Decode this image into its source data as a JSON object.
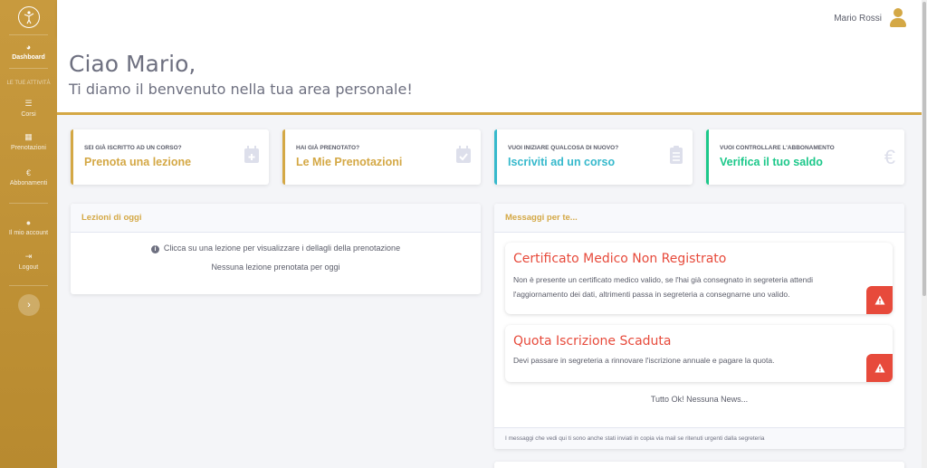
{
  "sidebar": {
    "items": [
      {
        "label": "Dashboard",
        "icon": "gauge-icon"
      },
      {
        "label": "Corsi",
        "icon": "list-icon"
      },
      {
        "label": "Prenotazioni",
        "icon": "calendar-icon"
      },
      {
        "label": "Abbonamenti",
        "icon": "euro-icon"
      },
      {
        "label": "Il mio account",
        "icon": "user-icon"
      },
      {
        "label": "Logout",
        "icon": "logout-icon"
      }
    ],
    "section_heading": "LE TUE ATTIVITÀ"
  },
  "topbar": {
    "user_name": "Mario Rossi"
  },
  "welcome": {
    "greeting": "Ciao Mario,",
    "subtitle": "Ti diamo il benvenuto nella tua area personale!"
  },
  "cards": [
    {
      "kicker": "SEI GIÀ ISCRITTO AD UN CORSO?",
      "title": "Prenota una lezione",
      "color": "#d4a845",
      "icon": "calendar-plus-icon"
    },
    {
      "kicker": "HAI GIÀ PRENOTATO?",
      "title": "Le Mie Prenotazioni",
      "color": "#d4a845",
      "icon": "calendar-check-icon"
    },
    {
      "kicker": "VUOI INIZIARE QUALCOSA DI NUOVO?",
      "title": "Iscriviti ad un corso",
      "color": "#36b9cc",
      "icon": "clipboard-list-icon"
    },
    {
      "kicker": "VUOI CONTROLLARE L'ABBONAMENTO",
      "title": "Verifica il tuo saldo",
      "color": "#1cc88a",
      "icon": "euro-icon"
    }
  ],
  "lessons_panel": {
    "title": "Lezioni di oggi",
    "info": "Clicca su una lezione per visualizzare i dellagli della prenotazione",
    "empty": "Nessuna lezione prenotata per oggi"
  },
  "messages_panel": {
    "title": "Messaggi per te...",
    "messages": [
      {
        "title": "Certificato Medico Non Registrato",
        "text": "Non è presente un certificato medico valido, se l'hai già consegnato in segreteria attendi l'aggiornamento dei dati, altrimenti passa in segreteria a consegnarne uno valido."
      },
      {
        "title": "Quota Iscrizione Scaduta",
        "text": "Devi passare in segreteria a rinnovare l'iscrizione annuale e pagare la quota."
      }
    ],
    "status": "Tutto Ok! Nessuna News...",
    "footer": "I messaggi che vedi qui ti sono anche stati inviati in copia via mail se ritenuti urgenti dalla segreteria"
  }
}
